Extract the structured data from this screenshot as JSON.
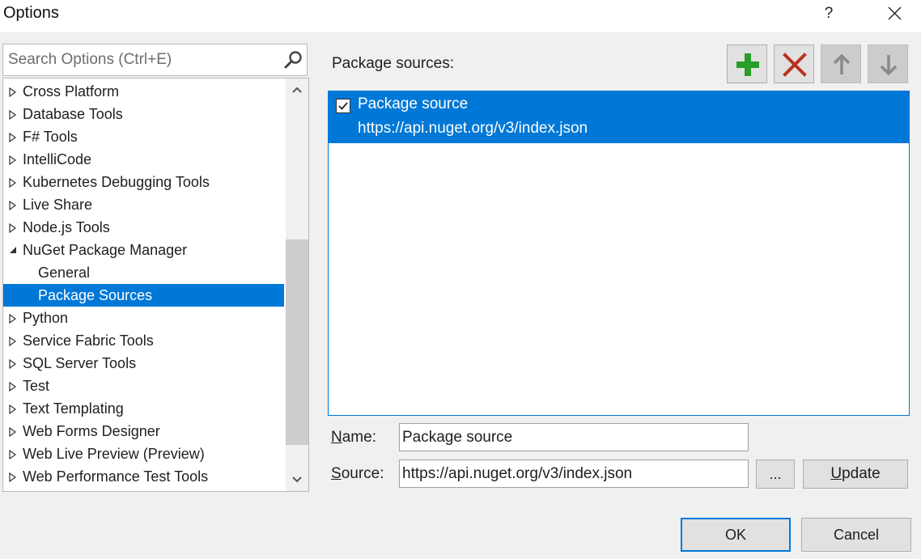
{
  "window": {
    "title": "Options",
    "help_label": "?"
  },
  "search": {
    "placeholder": "Search Options (Ctrl+E)"
  },
  "tree": {
    "items": [
      {
        "label": "Cross Platform",
        "expanded": false
      },
      {
        "label": "Database Tools",
        "expanded": false
      },
      {
        "label": "F# Tools",
        "expanded": false
      },
      {
        "label": "IntelliCode",
        "expanded": false
      },
      {
        "label": "Kubernetes Debugging Tools",
        "expanded": false
      },
      {
        "label": "Live Share",
        "expanded": false
      },
      {
        "label": "Node.js Tools",
        "expanded": false
      },
      {
        "label": "NuGet Package Manager",
        "expanded": true
      },
      {
        "label": "General",
        "child": true
      },
      {
        "label": "Package Sources",
        "child": true,
        "selected": true
      },
      {
        "label": "Python",
        "expanded": false
      },
      {
        "label": "Service Fabric Tools",
        "expanded": false
      },
      {
        "label": "SQL Server Tools",
        "expanded": false
      },
      {
        "label": "Test",
        "expanded": false
      },
      {
        "label": "Text Templating",
        "expanded": false
      },
      {
        "label": "Web Forms Designer",
        "expanded": false
      },
      {
        "label": "Web Live Preview (Preview)",
        "expanded": false
      },
      {
        "label": "Web Performance Test Tools",
        "expanded": false
      }
    ]
  },
  "panel": {
    "heading": "Package sources:",
    "toolbar": {
      "add_icon": "plus-icon",
      "remove_icon": "x-icon",
      "up_icon": "arrow-up-icon",
      "down_icon": "arrow-down-icon"
    },
    "sources": [
      {
        "name": "Package source",
        "url": "https://api.nuget.org/v3/index.json",
        "checked": true,
        "selected": true
      }
    ],
    "name_field": {
      "label_accel": "N",
      "label_rest": "ame:",
      "value": "Package source"
    },
    "source_field": {
      "label_accel": "S",
      "label_rest": "ource:",
      "value": "https://api.nuget.org/v3/index.json"
    },
    "browse_label": "...",
    "update_accel": "U",
    "update_rest": "pdate"
  },
  "footer": {
    "ok_label": "OK",
    "cancel_label": "Cancel"
  },
  "colors": {
    "selection": "#0078d7",
    "add_green": "#2a9d2a",
    "remove_red": "#b8321e"
  }
}
